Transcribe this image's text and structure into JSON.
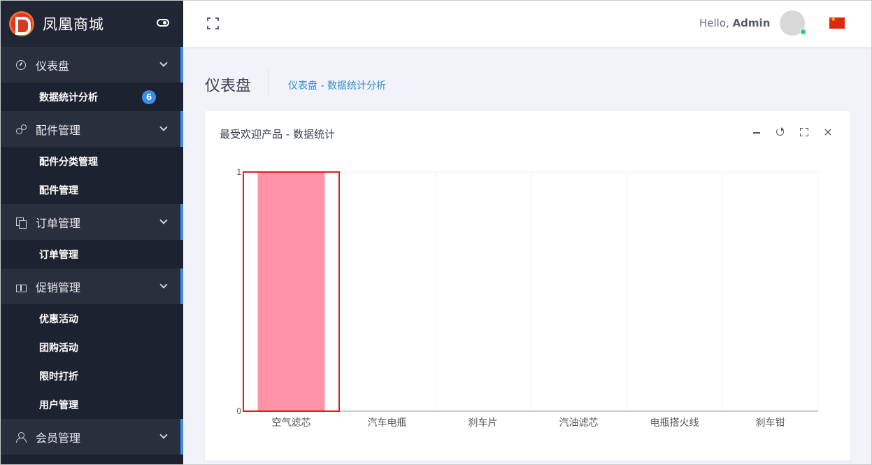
{
  "brand": {
    "name": "凤凰商城"
  },
  "sidebar": {
    "groups": [
      {
        "label": "仪表盘",
        "items": [
          {
            "label": "数据统计分析",
            "badge": "6"
          }
        ]
      },
      {
        "label": "配件管理",
        "items": [
          {
            "label": "配件分类管理"
          },
          {
            "label": "配件管理"
          }
        ]
      },
      {
        "label": "订单管理",
        "items": [
          {
            "label": "订单管理"
          }
        ]
      },
      {
        "label": "促销管理",
        "items": [
          {
            "label": "优惠活动"
          },
          {
            "label": "团购活动"
          },
          {
            "label": "限时打折"
          },
          {
            "label": "用户管理"
          }
        ]
      },
      {
        "label": "会员管理",
        "items": []
      }
    ]
  },
  "topbar": {
    "hello": "Hello,",
    "user": "Admin"
  },
  "page": {
    "title": "仪表盘",
    "breadcrumb": "仪表盘 - 数据统计分析"
  },
  "panel": {
    "title": "最受欢迎产品 - 数据统计",
    "close_glyph": "×"
  },
  "colors": {
    "bar": "#ff93a8",
    "highlight": "#e02020",
    "accent": "#3a8ee6",
    "sidebar": "#1d2230"
  },
  "chart_data": {
    "type": "bar",
    "categories": [
      "空气滤芯",
      "汽车电瓶",
      "刹车片",
      "汽油滤芯",
      "电瓶搭火线",
      "刹车钳"
    ],
    "values": [
      1,
      0,
      0,
      0,
      0,
      0
    ],
    "ylim": [
      0,
      1
    ],
    "yticks": [
      0,
      1
    ],
    "grid": true,
    "highlighted_category": "空气滤芯"
  }
}
